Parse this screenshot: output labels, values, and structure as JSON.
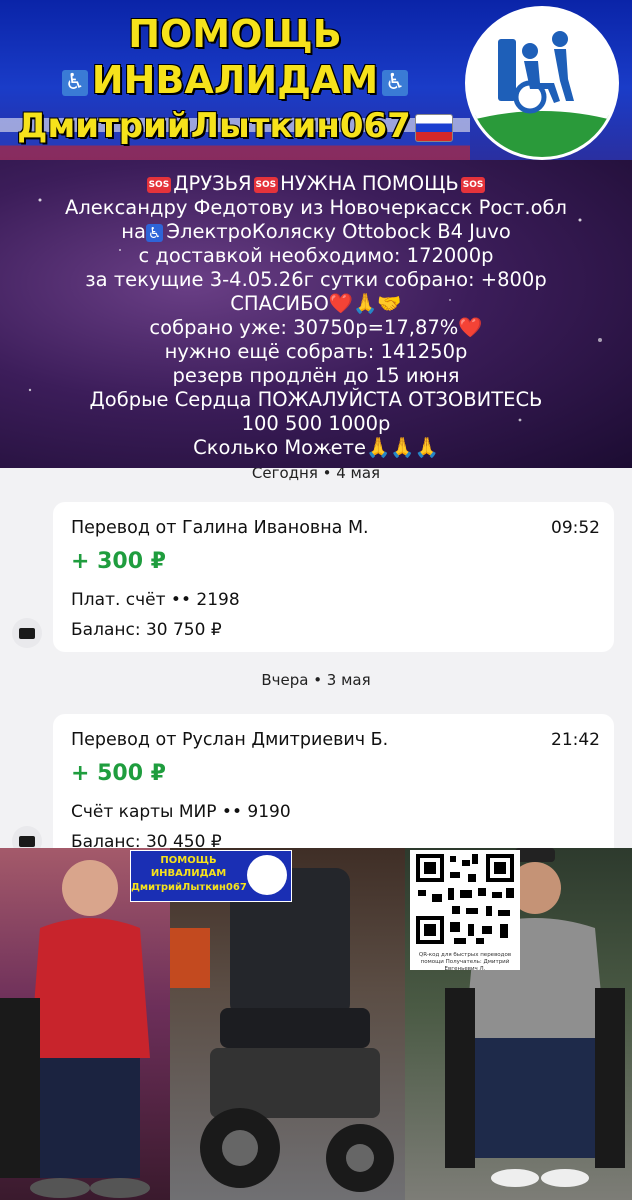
{
  "banner": {
    "line1": "ПОМОЩЬ",
    "line2": "ИНВАЛИДАМ",
    "line3": "ДмитрийЛыткин067",
    "accessible_icon": "♿"
  },
  "message": {
    "line1_a": "ДРУЗЬЯ",
    "line1_b": "НУЖНА ПОМОЩЬ",
    "sos": "SOS",
    "line2": "Александру Федотову из Новочеркасск Рост.обл",
    "line3_pre": "на",
    "line3": "ЭлектроКоляску Ottobock B4 Juvo",
    "line4": "с доставкой необходимо: 172000р",
    "line5": "за текущие 3-4.05.26г сутки собрано: +800р",
    "line6": "СПАСИБО❤️🙏🤝",
    "line7": "собрано уже: 30750р=17,87%❤️",
    "line8": "нужно ещё собрать: 141250р",
    "line9": "резерв продлён до 15 июня",
    "line10": "Добрые Сердца ПОЖАЛУЙСТА ОТЗОВИТЕСЬ",
    "line11": "100 500 1000р",
    "line12": "Сколько Можете🙏🙏🙏"
  },
  "feed": {
    "day1": "Сегодня • 4 мая",
    "day2": "Вчера • 3 мая",
    "transactions": [
      {
        "title": "Перевод от Галина Ивановна М.",
        "time": "09:52",
        "amount": "+ 300 ₽",
        "account": "Плат. счёт •• 2198",
        "balance": "Баланс: 30 750 ₽"
      },
      {
        "title": "Перевод от Руслан Дмитриевич Б.",
        "time": "21:42",
        "amount": "+ 500 ₽",
        "account": "Счёт карты МИР •• 9190",
        "balance": "Баланс: 30 450 ₽"
      }
    ]
  },
  "collage": {
    "mini_line1": "ПОМОЩЬ",
    "mini_line2": "ИНВАЛИДАМ",
    "mini_line3": "ДмитрийЛыткин067",
    "qr_caption": "QR-код для быстрых переводов помощи Получатель: Дмитрий Евгеньевич Л."
  },
  "colors": {
    "amount_green": "#1f9d3e",
    "banner_yellow": "#f6e21b",
    "banner_blue": "#1a3cc8"
  }
}
